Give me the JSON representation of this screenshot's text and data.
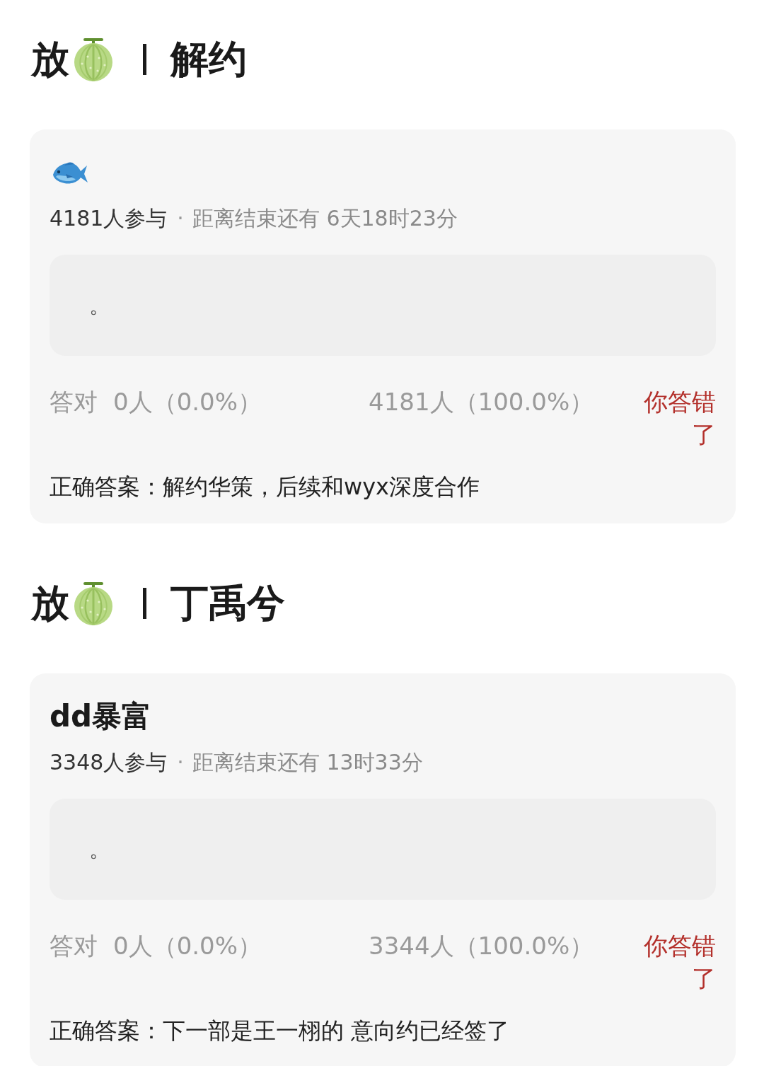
{
  "sections": [
    {
      "header": {
        "prefix": "放",
        "title": "解约"
      },
      "card": {
        "question": {
          "kind": "icon"
        },
        "participants": "4181人参与",
        "separator": "·",
        "countdown": "距离结束还有 6天18时23分",
        "option": "。",
        "correct_label": "答对",
        "correct_count": "0人（0.0%）",
        "wrong_count": "4181人（100.0%）",
        "result": {
          "kind": "wrong",
          "text": "你答错了"
        },
        "answer": "正确答案：解约华策，后续和wyx深度合作"
      }
    },
    {
      "header": {
        "prefix": "放",
        "title": "丁禹兮"
      },
      "card": {
        "question": {
          "kind": "text",
          "text": "dd暴富"
        },
        "participants": "3348人参与",
        "separator": "·",
        "countdown": "距离结束还有 13时33分",
        "option": "。",
        "correct_label": "答对",
        "correct_count": "0人（0.0%）",
        "wrong_count": "3344人（100.0%）",
        "result": {
          "kind": "wrong",
          "text": "你答错了"
        },
        "answer": "正确答案：下一部是王一栩的 意向约已经签了"
      }
    }
  ]
}
